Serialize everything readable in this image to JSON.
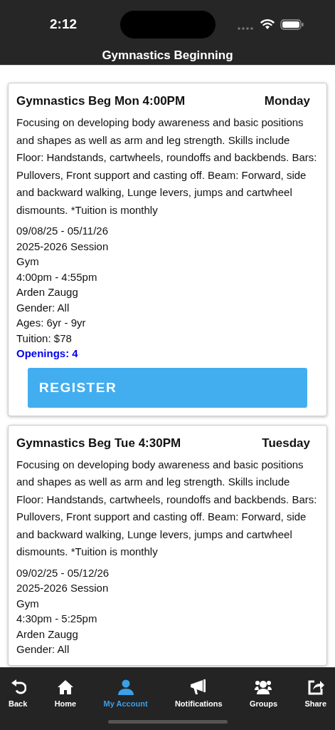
{
  "status_bar": {
    "time": "2:12"
  },
  "header": {
    "title": "Gymnastics Beginning"
  },
  "classes": [
    {
      "title": "Gymnastics Beg Mon 4:00PM",
      "day": "Monday",
      "description": "Focusing on developing body awareness and basic positions and shapes as well as arm and leg strength. Skills include Floor: Handstands, cartwheels, roundoffs and backbends. Bars: Pullovers, Front support and casting off. Beam: Forward, side and backward walking, Lunge levers, jumps and cartwheel dismounts. *Tuition is monthly",
      "details": [
        "09/08/25 - 05/11/26",
        "2025-2026 Session",
        "Gym",
        "4:00pm - 4:55pm",
        "Arden Zaugg",
        "Gender: All",
        "Ages: 6yr - 9yr",
        "Tuition: $78"
      ],
      "openings": "Openings: 4",
      "button": "REGISTER"
    },
    {
      "title": "Gymnastics Beg Tue 4:30PM",
      "day": "Tuesday",
      "description": "Focusing on developing body awareness and basic positions and shapes as well as arm and leg strength. Skills include Floor: Handstands, cartwheels, roundoffs and backbends. Bars: Pullovers, Front support and casting off. Beam: Forward, side and backward walking, Lunge levers, jumps and cartwheel dismounts. *Tuition is monthly",
      "details": [
        "09/02/25 - 05/12/26",
        "2025-2026 Session",
        "Gym",
        "4:30pm - 5:25pm",
        "Arden Zaugg",
        "Gender: All"
      ]
    }
  ],
  "tab_bar": [
    {
      "label": "Back",
      "selected": false
    },
    {
      "label": "Home",
      "selected": false
    },
    {
      "label": "My Account",
      "selected": true
    },
    {
      "label": "Notifications",
      "selected": false
    },
    {
      "label": "Groups",
      "selected": false
    },
    {
      "label": "Share",
      "selected": false
    }
  ]
}
